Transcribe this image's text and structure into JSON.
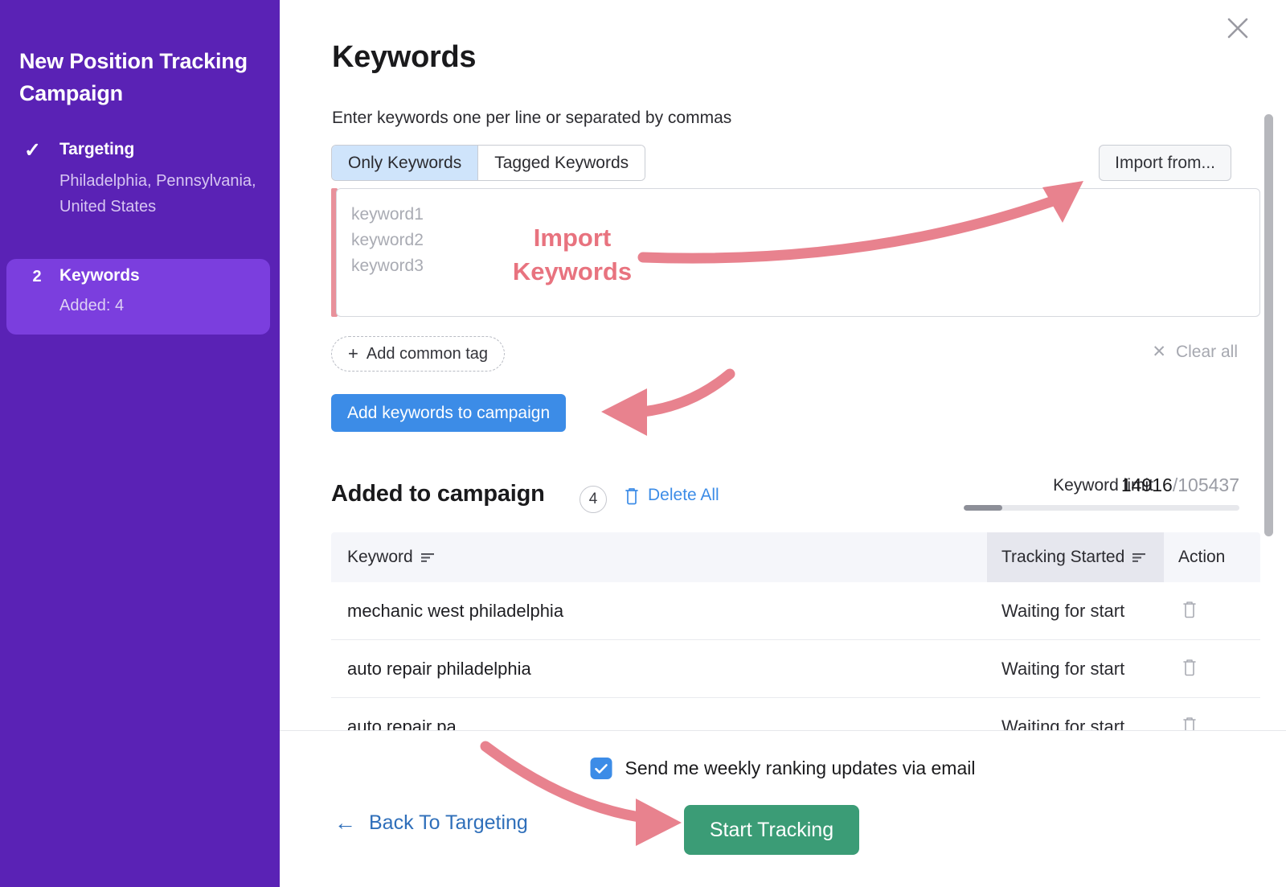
{
  "sidebar": {
    "title": "New Position Tracking Campaign",
    "steps": [
      {
        "marker": "✓",
        "marker_type": "check",
        "label": "Targeting",
        "sub": "Philadelphia, Pennsylvania, United States",
        "active": false
      },
      {
        "marker": "2",
        "marker_type": "number",
        "label": "Keywords",
        "sub": "Added: 4",
        "active": true
      }
    ],
    "bg_color": "#5a22b5",
    "active_color": "#7b3ede"
  },
  "main": {
    "close_label": "close-icon",
    "page_title": "Keywords",
    "subtitle": "Enter keywords one per line or separated by commas",
    "segmented": {
      "options": [
        "Only Keywords",
        "Tagged Keywords"
      ],
      "selected": "Only Keywords"
    },
    "import_button": "Import from...",
    "textarea": {
      "placeholder": "keyword1\nkeyword2\nkeyword3",
      "value": ""
    },
    "add_common_tag": "Add common tag",
    "add_tag_plus": "+",
    "clear_all": "Clear all",
    "clear_all_x": "✕",
    "add_keywords_button": "Add keywords to campaign"
  },
  "added_section": {
    "title": "Added to campaign",
    "count": "4",
    "delete_all": "Delete All",
    "keyword_limit_label": "Keyword limit",
    "keyword_limit_used": "14916",
    "keyword_limit_separator": "/",
    "keyword_limit_total": "105437",
    "keyword_limit_percent": 14
  },
  "table": {
    "columns": [
      "Keyword",
      "Tracking Started",
      "Action"
    ],
    "rows": [
      {
        "keyword": "mechanic west philadelphia",
        "tracking": "Waiting for start",
        "action": "trash-icon"
      },
      {
        "keyword": "auto repair philadelphia",
        "tracking": "Waiting for start",
        "action": "trash-icon"
      },
      {
        "keyword": "auto repair pa",
        "tracking": "Waiting for start",
        "action": "trash-icon"
      }
    ]
  },
  "footer": {
    "checkbox_label": "Send me weekly ranking updates via email",
    "checkbox_checked": true,
    "back_link": "Back To Targeting",
    "back_arrow": "←",
    "start_button": "Start Tracking"
  },
  "annotations": [
    {
      "id": "import-keywords",
      "text": "Import\nKeywords",
      "color": "#e8737f"
    }
  ],
  "colors": {
    "sidebar_purple": "#5a22b5",
    "sidebar_active_purple": "#7b3ede",
    "primary_blue": "#3c8ce7",
    "green": "#3b9c76",
    "annotation_pink": "#e8737f",
    "accent_bar_pink": "#e8919b"
  }
}
